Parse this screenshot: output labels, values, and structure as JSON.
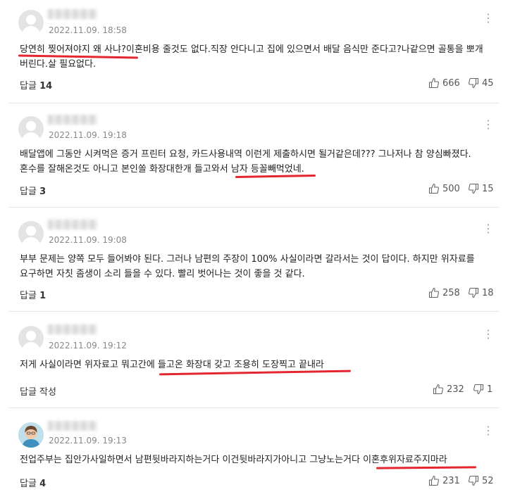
{
  "comments": [
    {
      "date": "2022.11.09. 18:58",
      "text": "당연히 찢어져야지 왜 사냐?이혼비용 줄것도 없다.직장 안다니고 집에 있으면서 배달 음식만 준다고?나같으면 골통을 뽀개 버린다.살 필요없다.",
      "reply_label": "답글",
      "reply_count": "14",
      "likes": "666",
      "dislikes": "45"
    },
    {
      "date": "2022.11.09. 19:18",
      "text": "배달앱에 그동안 시켜먹은 증거 프린터 요청, 카드사용내역 이런게 제출하시면 될거같은데??? 그나저나 참 양심빠졌다. 혼수를 잘해온것도 아니고 본인쏠 화장대한개 들고와서 남자 등꼴빼먹었네.",
      "reply_label": "답글",
      "reply_count": "3",
      "likes": "500",
      "dislikes": "15"
    },
    {
      "date": "2022.11.09. 19:08",
      "text": "부부 문제는 양쪽 모두 들어봐야 된다. 그러나 남편의 주장이 100% 사실이라면 갈라서는 것이 답이다. 하지만 위자료를 요구하면 자칫 좀생이 소리 들을 수 있다. 빨리 벗어나는 것이 좋을 것 같다.",
      "reply_label": "답글",
      "reply_count": "1",
      "likes": "258",
      "dislikes": "18"
    },
    {
      "date": "2022.11.09. 19:12",
      "text": "저게 사실이라면 위자료고 뭐고간에 들고온 화장대 갖고 조용히 도장찍고 끝내라",
      "reply_label": "답글 작성",
      "reply_count": "",
      "likes": "232",
      "dislikes": "1"
    },
    {
      "date": "2022.11.09. 19:13",
      "text": "전업주부는 집안가사일하면서 남편뒷바라지하는거다 이건뒷바라지가아니고 그냥노는거다 이혼후위자료주지마라",
      "reply_label": "답글",
      "reply_count": "4",
      "likes": "231",
      "dislikes": "52"
    }
  ],
  "icons": {
    "more": "more-vertical-icon",
    "like": "thumbs-up-icon",
    "dislike": "thumbs-down-icon",
    "avatar": "default-user-avatar-icon"
  },
  "colors": {
    "underline": "#e3262f",
    "meta": "#888888"
  }
}
